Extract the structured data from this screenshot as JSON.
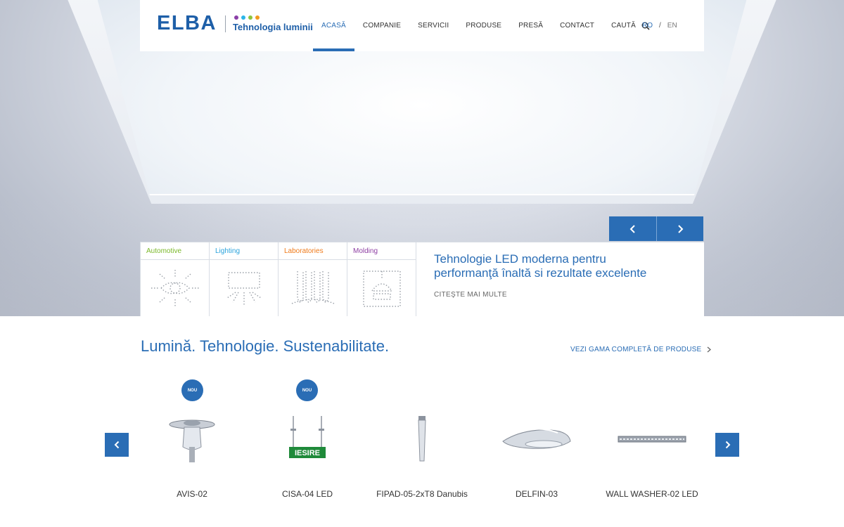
{
  "brand": {
    "name": "ELBA",
    "tagline": "Tehnologia luminii",
    "dot_colors": [
      "#8b3fa8",
      "#2bb5e8",
      "#8cc63f",
      "#f39a1e"
    ]
  },
  "nav": {
    "items": [
      {
        "label": "ACASĂ",
        "active": true
      },
      {
        "label": "COMPANIE"
      },
      {
        "label": "SERVICII"
      },
      {
        "label": "PRODUSE"
      },
      {
        "label": "PRESĂ"
      },
      {
        "label": "CONTACT"
      },
      {
        "label": "CAUTĂ",
        "icon": "search-icon"
      }
    ],
    "lang": {
      "ro": "RO",
      "separator": "/",
      "en": "EN"
    }
  },
  "hero": {
    "categories": [
      {
        "label": "Automotive",
        "color": "#7ab829",
        "icon": "automotive-light-icon"
      },
      {
        "label": "Lighting",
        "color": "#2aa3dc",
        "icon": "lighting-icon"
      },
      {
        "label": "Laboratories",
        "color": "#ef7a1a",
        "icon": "laboratories-icon"
      },
      {
        "label": "Molding",
        "color": "#8e3fa3",
        "icon": "molding-icon"
      }
    ],
    "feature": {
      "title_line1": "Tehnologie LED moderna pentru",
      "title_line2": "performanţă înaltă si rezultate excelente",
      "link": "CITEŞTE MAI MULTE"
    }
  },
  "products_section": {
    "title": "Lumină. Tehnologie. Sustenabilitate.",
    "range_link": "VEZI GAMA COMPLETĂ DE PRODUSE",
    "badge_text": "NOU",
    "products": [
      {
        "name": "AVIS-02",
        "new": true
      },
      {
        "name": "CISA-04 LED",
        "new": true,
        "sign_text": "IESIRE"
      },
      {
        "name": "FIPAD-05-2xT8 Danubis",
        "new": false
      },
      {
        "name": "DELFIN-03",
        "new": false
      },
      {
        "name": "WALL WASHER-02 LED",
        "new": false
      }
    ]
  },
  "colors": {
    "accent": "#2a6db5",
    "brand_blue": "#1e5fa8"
  }
}
